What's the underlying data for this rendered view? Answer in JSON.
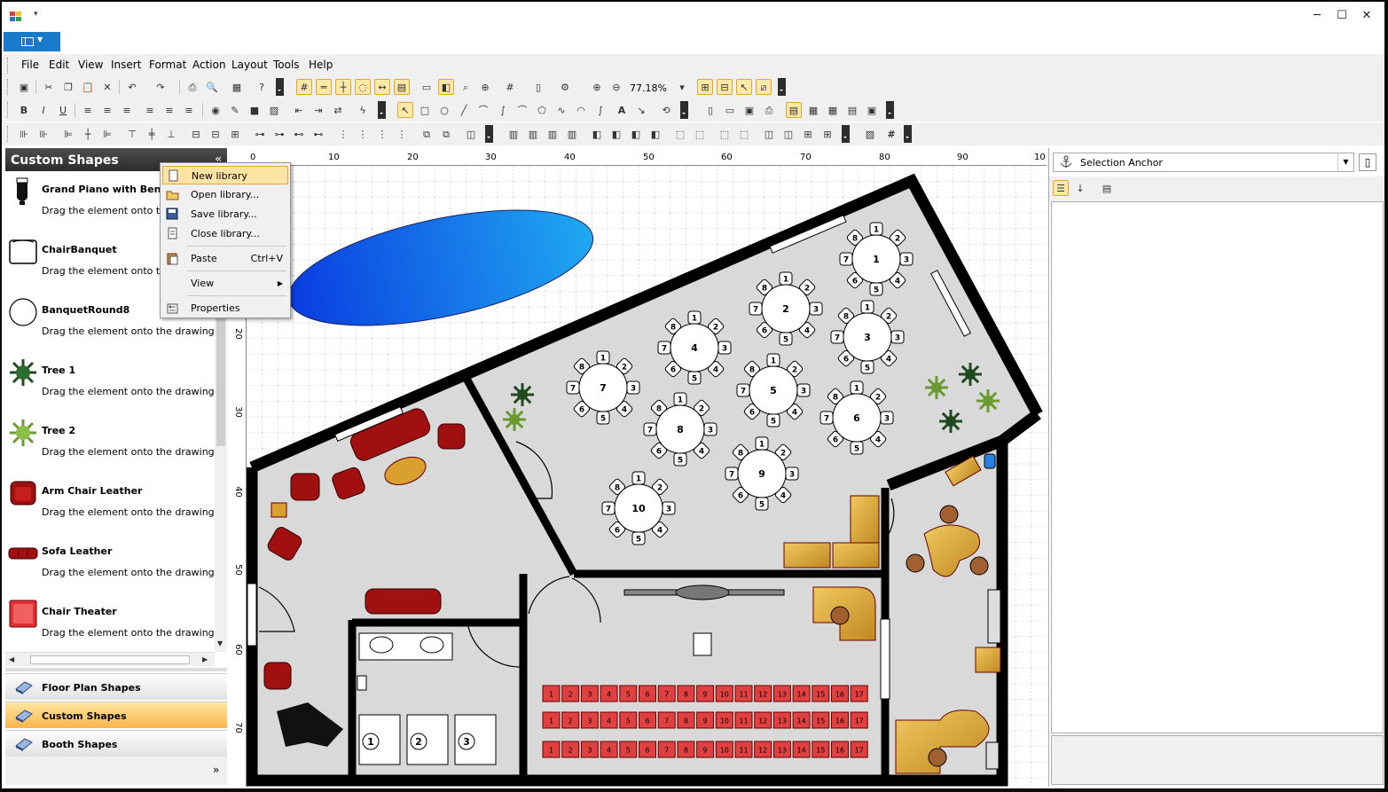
{
  "window": {
    "qa_arrow": "▾",
    "minimize": "─",
    "maximize": "☐",
    "close": "✕"
  },
  "menu": [
    "File",
    "Edit",
    "View",
    "Insert",
    "Format",
    "Action",
    "Layout",
    "Tools",
    "Help"
  ],
  "toolbar": {
    "zoom": "77.18%"
  },
  "left_panel": {
    "title": "Custom Shapes",
    "collapse": "«",
    "shapes": [
      {
        "name": "Grand Piano with Bench",
        "hint": "Drag the element onto the d"
      },
      {
        "name": "ChairBanquet",
        "hint": "Drag the element onto the d"
      },
      {
        "name": "BanquetRound8",
        "hint": "Drag the element onto the drawing"
      },
      {
        "name": "Tree 1",
        "hint": "Drag the element onto the drawing"
      },
      {
        "name": "Tree 2",
        "hint": "Drag the element onto the drawing"
      },
      {
        "name": "Arm Chair Leather",
        "hint": "Drag the element onto the drawing"
      },
      {
        "name": "Sofa Leather",
        "hint": "Drag the element onto the drawing"
      },
      {
        "name": "Chair Theater",
        "hint": "Drag the element onto the drawing"
      }
    ],
    "libraries": [
      "Floor Plan Shapes",
      "Custom Shapes",
      "Booth Shapes"
    ],
    "more": "»"
  },
  "context_menu": {
    "items": [
      {
        "label": "New library",
        "shortcut": ""
      },
      {
        "label": "Open library...",
        "shortcut": ""
      },
      {
        "label": "Save library...",
        "shortcut": ""
      },
      {
        "label": "Close library...",
        "shortcut": ""
      },
      {
        "label": "Paste",
        "shortcut": "Ctrl+V"
      },
      {
        "label": "View",
        "shortcut": "▶"
      },
      {
        "label": "Properties",
        "shortcut": ""
      }
    ]
  },
  "ruler": {
    "h": [
      "0",
      "10",
      "20",
      "30",
      "40",
      "50",
      "60",
      "70",
      "80",
      "90",
      "10"
    ],
    "v": [
      "20",
      "30",
      "40",
      "50",
      "60",
      "70"
    ]
  },
  "floor_plan": {
    "tables": [
      "1",
      "2",
      "3",
      "4",
      "5",
      "6",
      "7",
      "8",
      "9",
      "10"
    ],
    "table_seats": [
      "1",
      "2",
      "3",
      "4",
      "5",
      "6",
      "7",
      "8"
    ],
    "theater_seats": [
      "1",
      "2",
      "3",
      "4",
      "5",
      "6",
      "7",
      "8",
      "9",
      "10",
      "11",
      "12",
      "13",
      "14",
      "15",
      "16",
      "17"
    ],
    "restrooms": [
      "1",
      "2",
      "3"
    ]
  },
  "right_panel": {
    "selected_object": "Selection Anchor",
    "dropdown": "▼",
    "pages_icon": "▯"
  },
  "colors": {
    "accent_blue": "#1979ca",
    "highlight": "#fde3a4",
    "pool": "#1a78e0",
    "leather": "#a01010",
    "wood": "#d9a030",
    "floor": "#d9d9d9"
  }
}
